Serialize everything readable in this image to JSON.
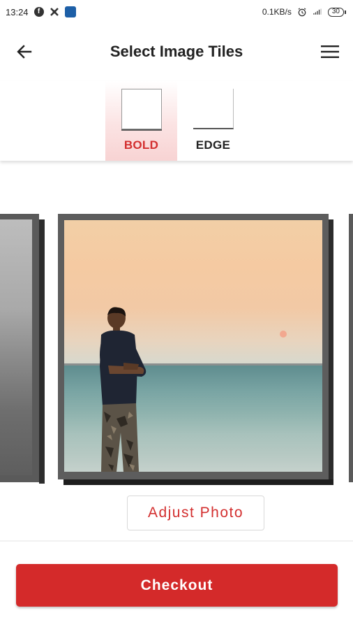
{
  "status_bar": {
    "time": "13:24",
    "net_speed": "0.1KB/s",
    "battery": "30",
    "icons": [
      "facebook-icon",
      "app-notification-icon",
      "book-app-icon",
      "alarm-icon",
      "signal-icon",
      "battery-icon"
    ]
  },
  "app_bar": {
    "title": "Select Image Tiles",
    "back_icon": "arrow-back-icon",
    "menu_icon": "hamburger-menu-icon"
  },
  "tile_styles": {
    "selected": "BOLD",
    "options": [
      {
        "label": "BOLD"
      },
      {
        "label": "EDGE"
      }
    ]
  },
  "carousel": {
    "current_photo": "person-on-beach-at-sunset"
  },
  "actions": {
    "adjust_label": "Adjust Photo",
    "checkout_label": "Checkout"
  },
  "colors": {
    "accent": "#d42a2a",
    "selected_tab_bg": "#f8d3d3",
    "tile_frame": "#5d5d5d"
  }
}
